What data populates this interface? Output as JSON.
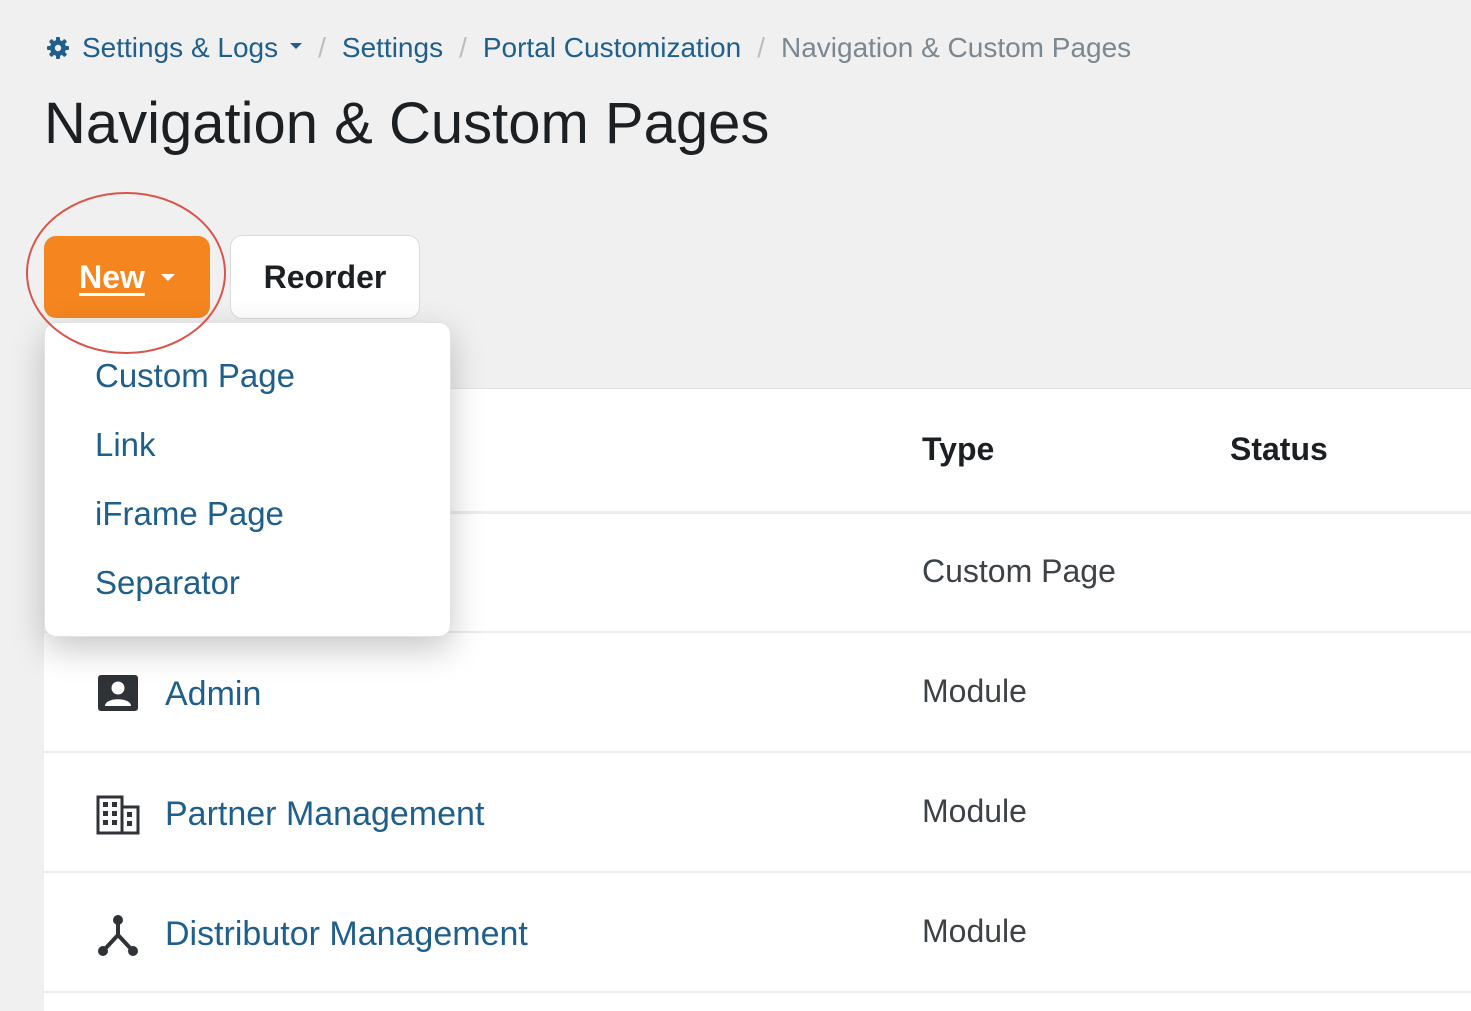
{
  "breadcrumb": {
    "root": "Settings & Logs",
    "settings": "Settings",
    "portal": "Portal Customization",
    "current": "Navigation & Custom Pages",
    "separator": "/"
  },
  "page_title": "Navigation & Custom Pages",
  "toolbar": {
    "new_label": "New",
    "reorder_label": "Reorder"
  },
  "new_menu": {
    "items": [
      {
        "label": "Custom Page"
      },
      {
        "label": "Link"
      },
      {
        "label": "iFrame Page"
      },
      {
        "label": "Separator"
      }
    ]
  },
  "table": {
    "headers": {
      "type": "Type",
      "status": "Status"
    },
    "rows": [
      {
        "name": "",
        "type": "Custom Page",
        "status": "",
        "icon": ""
      },
      {
        "name": "Admin",
        "type": "Module",
        "status": "",
        "icon": "admin-icon"
      },
      {
        "name": "Partner Management",
        "type": "Module",
        "status": "",
        "icon": "building-icon"
      },
      {
        "name": "Distributor Management",
        "type": "Module",
        "status": "",
        "icon": "distribution-icon"
      }
    ]
  },
  "colors": {
    "primary_button": "#f5861f",
    "link": "#1f5f8b",
    "annotation": "#d9554b",
    "background": "#f0f0f0"
  }
}
